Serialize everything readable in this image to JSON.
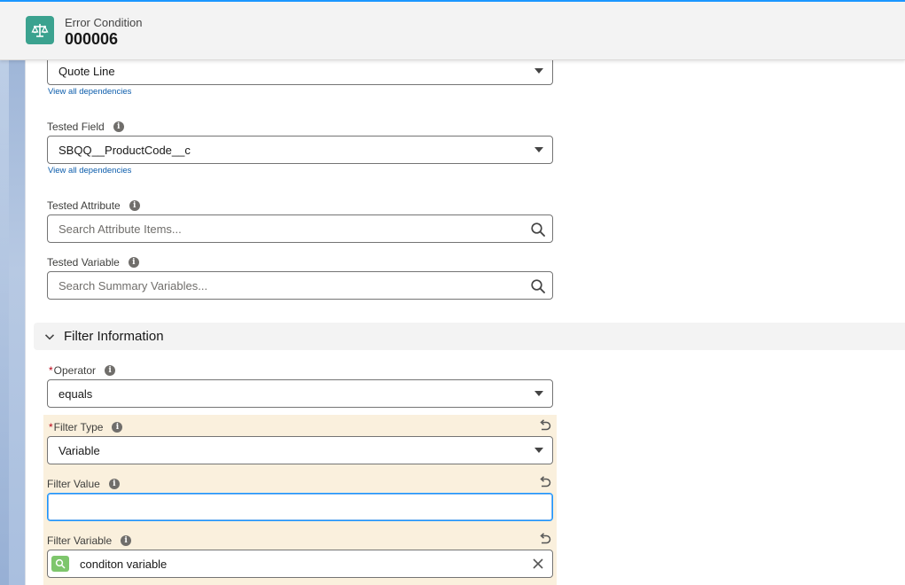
{
  "header": {
    "object_label": "Error Condition",
    "record_name": "000006"
  },
  "fields": {
    "tested_object": {
      "value": "Quote Line",
      "link": "View all dependencies"
    },
    "tested_field": {
      "label": "Tested Field",
      "value": "SBQQ__ProductCode__c",
      "link": "View all dependencies"
    },
    "tested_attribute": {
      "label": "Tested Attribute",
      "placeholder": "Search Attribute Items..."
    },
    "tested_variable": {
      "label": "Tested Variable",
      "placeholder": "Search Summary Variables..."
    }
  },
  "filter_section": {
    "title": "Filter Information",
    "operator": {
      "label": "Operator",
      "value": "equals"
    },
    "filter_type": {
      "label": "Filter Type",
      "value": "Variable"
    },
    "filter_value": {
      "label": "Filter Value",
      "value": ""
    },
    "filter_variable": {
      "label": "Filter Variable",
      "value": "conditon variable"
    }
  },
  "common": {
    "required_mark": "*",
    "info_glyph": "i"
  },
  "colors": {
    "brand_icon": "#3ba28f",
    "changed_field_bg": "#faf0dd",
    "focus_border": "#1b96ff",
    "lookup_icon": "#7ec66c"
  }
}
